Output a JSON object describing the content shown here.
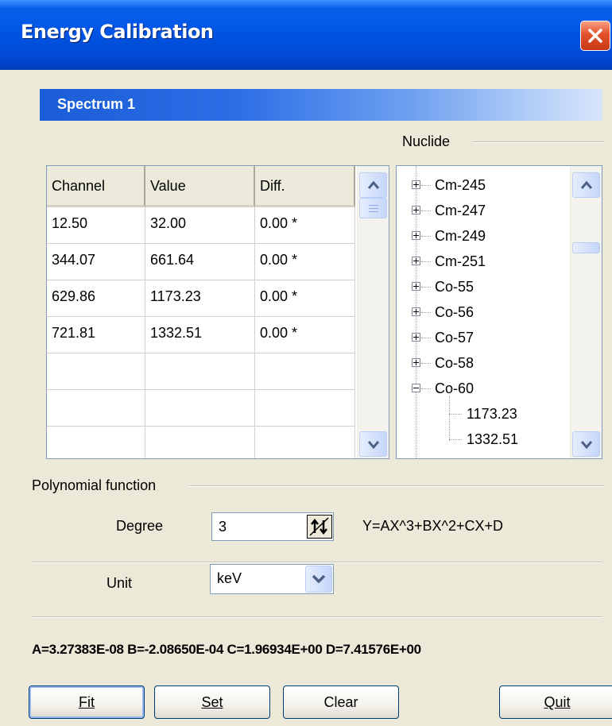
{
  "window": {
    "title": "Energy Calibration"
  },
  "spectrum": {
    "label": "Spectrum 1"
  },
  "nuclide_group": {
    "label": "Nuclide"
  },
  "table": {
    "columns": [
      "Channel",
      "Value",
      "Diff."
    ],
    "rows": [
      {
        "channel": "12.50",
        "value": "32.00",
        "diff": "0.00 *"
      },
      {
        "channel": "344.07",
        "value": "661.64",
        "diff": "0.00 *"
      },
      {
        "channel": "629.86",
        "value": "1173.23",
        "diff": "0.00 *"
      },
      {
        "channel": "721.81",
        "value": "1332.51",
        "diff": "0.00 *"
      }
    ]
  },
  "nuclide_tree": {
    "items": [
      "Cm-245",
      "Cm-247",
      "Cm-249",
      "Cm-251",
      "Co-55",
      "Co-56",
      "Co-57",
      "Co-58",
      "Co-60"
    ],
    "expanded_item": "Co-60",
    "children": [
      "1173.23",
      "1332.51"
    ]
  },
  "polynomial": {
    "label": "Polynomial function",
    "degree_label": "Degree",
    "degree_value": "3",
    "formula": "Y=AX^3+BX^2+CX+D"
  },
  "unit": {
    "label": "Unit",
    "selected": "keV"
  },
  "coefficients": "A=3.27383E-08  B=-2.08650E-04  C=1.96934E+00  D=7.41576E+00",
  "buttons": {
    "fit": "Fit",
    "set": "Set",
    "clear": "Clear",
    "quit": "Quit"
  },
  "colors": {
    "title_bar": "#0055e5",
    "spectrum_bar": "#1b5dd6",
    "dialog_bg": "#ece9d8",
    "close_button": "#e2512a"
  },
  "icons": [
    "close-icon",
    "scroll-up-icon",
    "scroll-down-icon",
    "expand-icon",
    "collapse-icon",
    "spin-icon",
    "dropdown-arrow-icon"
  ]
}
